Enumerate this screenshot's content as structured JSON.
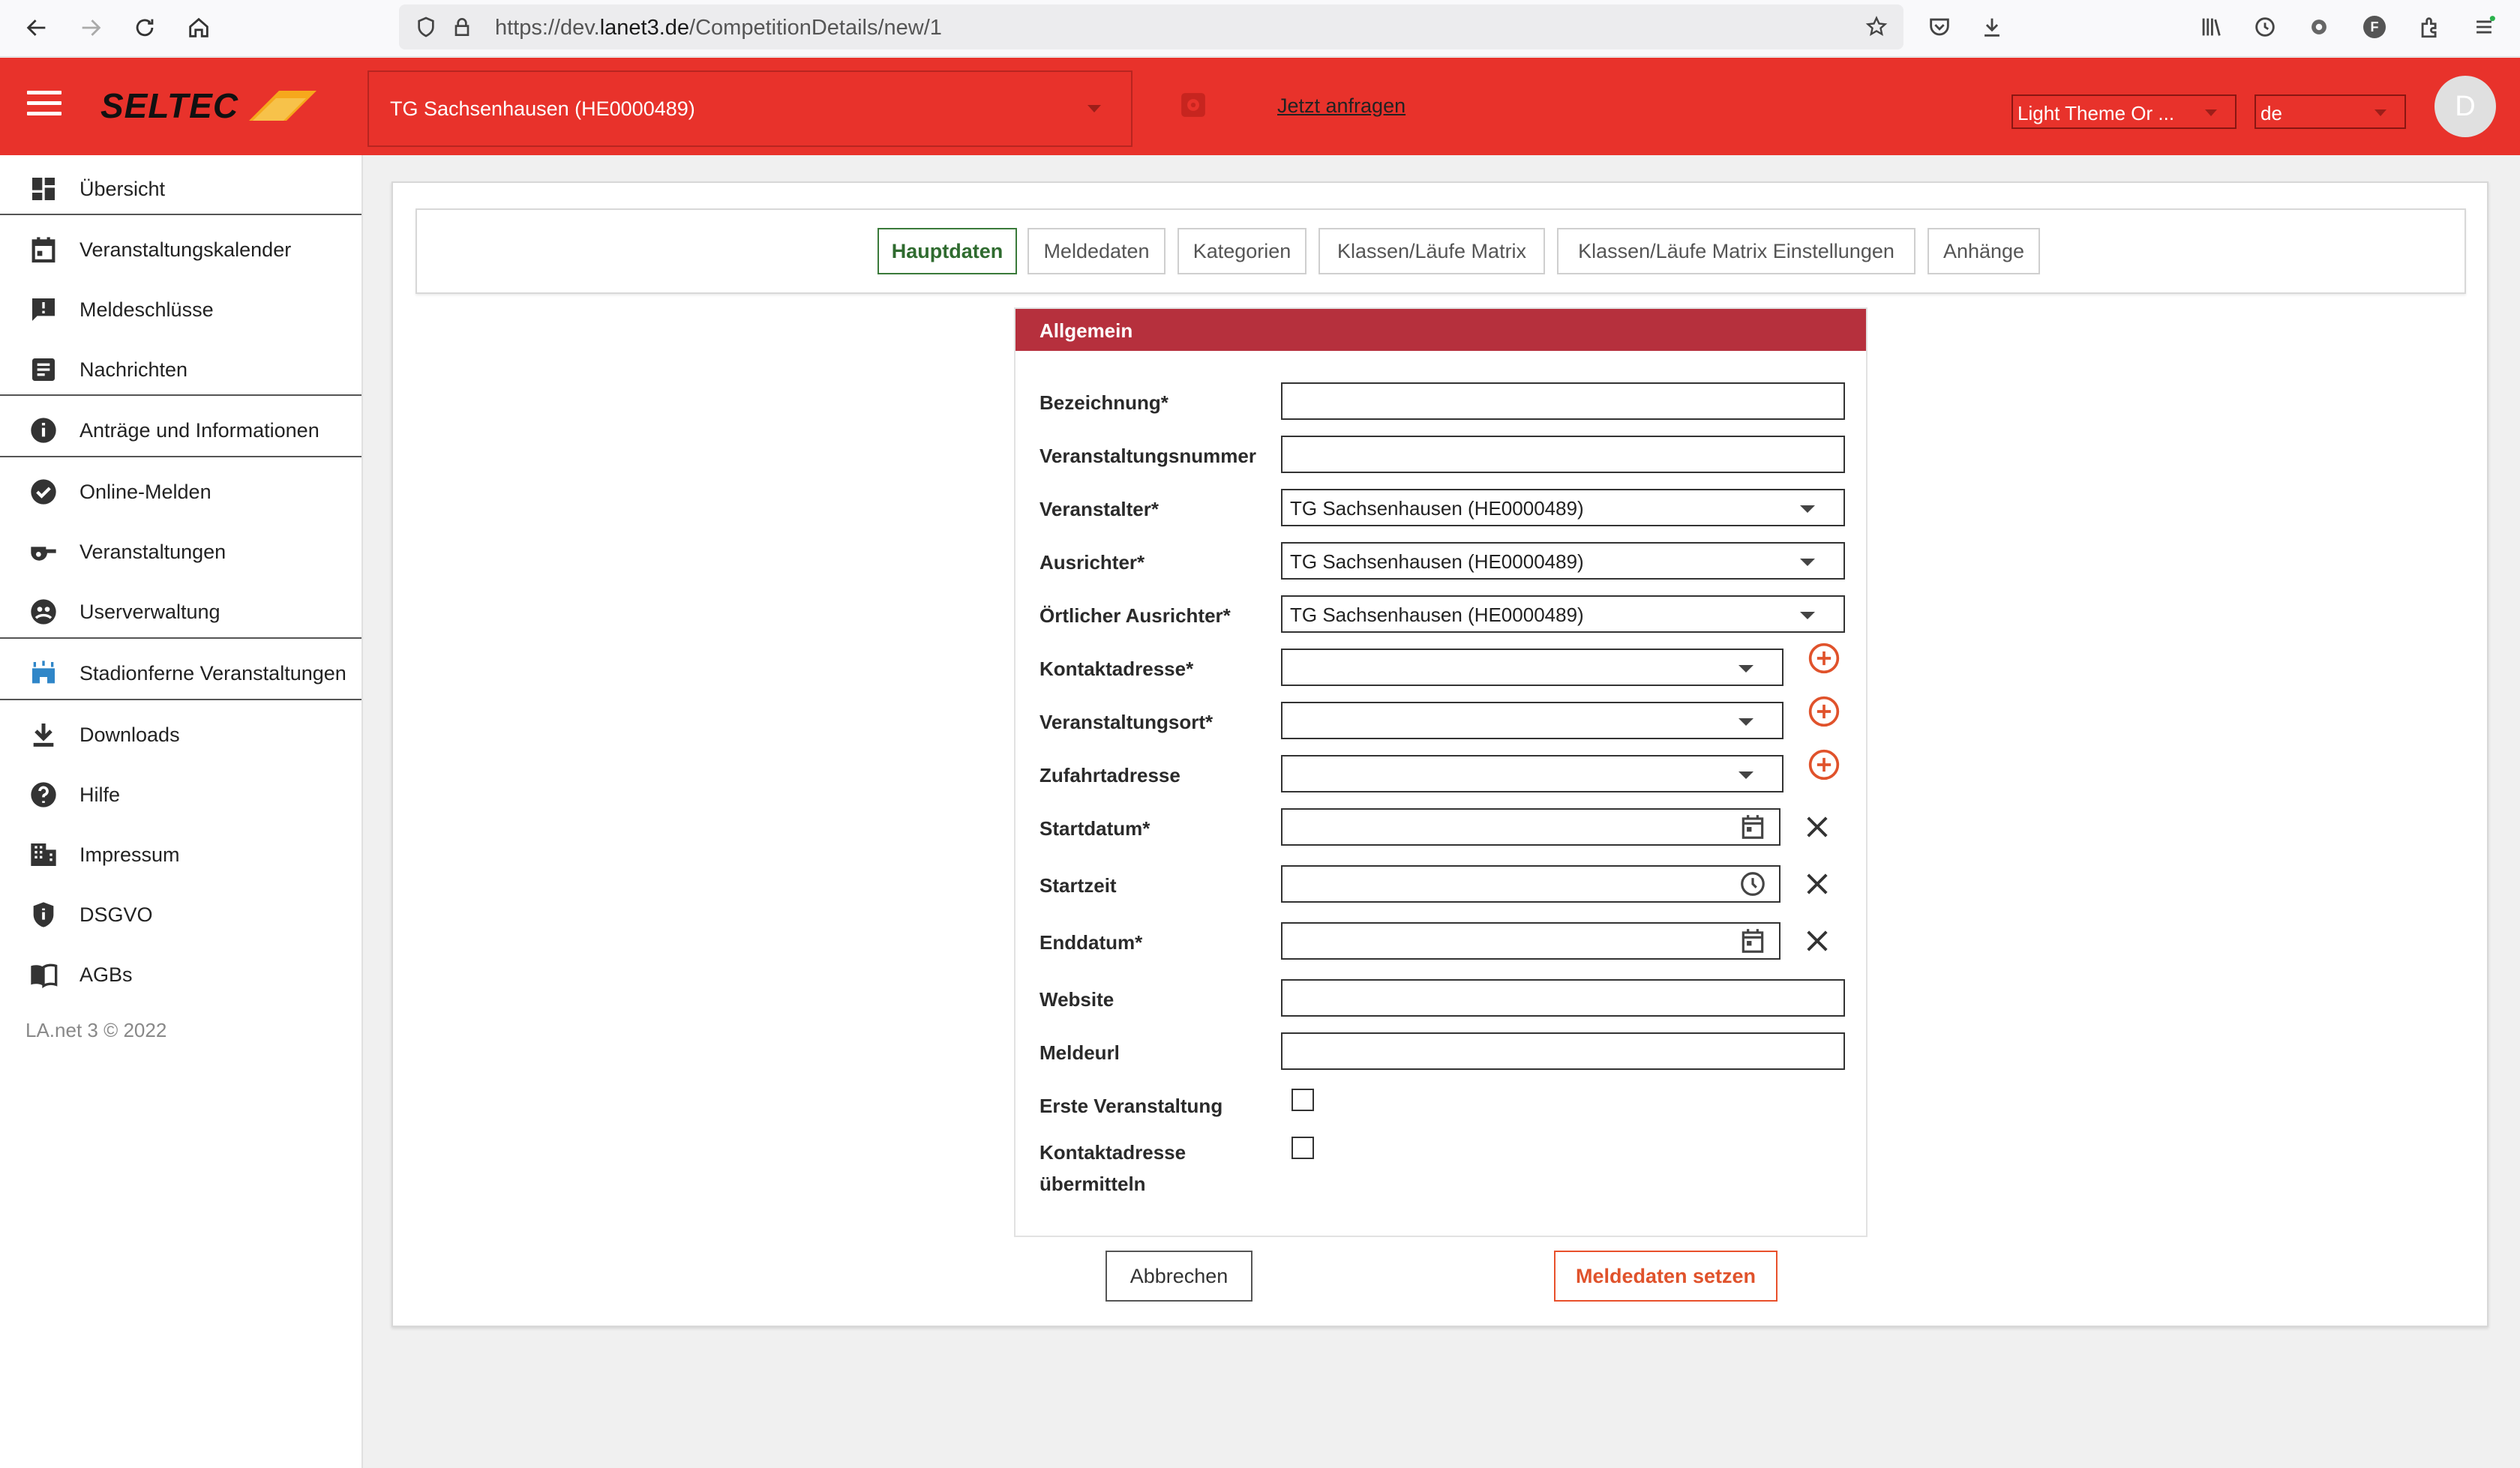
{
  "browser": {
    "url_prefix": "https://dev.",
    "url_domain": "lanet3.de",
    "url_path": "/CompetitionDetails/new/1",
    "profile_letter": "F"
  },
  "header": {
    "org_selected": "TG Sachsenhausen (HE0000489)",
    "request_link": "Jetzt anfragen",
    "theme_select": "Light Theme Or ...",
    "lang_select": "de",
    "avatar_letter": "D"
  },
  "sidebar": {
    "items": [
      {
        "label": "Übersicht",
        "icon": "dashboard-icon"
      },
      {
        "label": "Veranstaltungskalender",
        "icon": "calendar-icon"
      },
      {
        "label": "Meldeschlüsse",
        "icon": "feedback-icon"
      },
      {
        "label": "Nachrichten",
        "icon": "article-icon"
      },
      {
        "label": "Anträge und Informationen",
        "icon": "info-icon"
      },
      {
        "label": "Online-Melden",
        "icon": "check-circle-icon"
      },
      {
        "label": "Veranstaltungen",
        "icon": "whistle-icon"
      },
      {
        "label": "Userverwaltung",
        "icon": "support-icon"
      },
      {
        "label": "Stadionferne Veranstaltungen",
        "icon": "stadium-icon"
      },
      {
        "label": "Downloads",
        "icon": "download-icon"
      },
      {
        "label": "Hilfe",
        "icon": "help-icon"
      },
      {
        "label": "Impressum",
        "icon": "building-icon"
      },
      {
        "label": "DSGVO",
        "icon": "shield-icon"
      },
      {
        "label": "AGBs",
        "icon": "book-icon"
      }
    ],
    "copyright": "LA.net 3 © 2022"
  },
  "tabs": [
    "Hauptdaten",
    "Meldedaten",
    "Kategorien",
    "Klassen/Läufe Matrix",
    "Klassen/Läufe Matrix Einstellungen",
    "Anhänge"
  ],
  "form": {
    "section_title": "Allgemein",
    "labels": {
      "bezeichnung": "Bezeichnung*",
      "veranstaltungsnummer": "Veranstaltungsnummer",
      "veranstalter": "Veranstalter*",
      "ausrichter": "Ausrichter*",
      "oertlicher_ausrichter": "Örtlicher Ausrichter*",
      "kontaktadresse": "Kontaktadresse*",
      "veranstaltungsort": "Veranstaltungsort*",
      "zufahrtadresse": "Zufahrtadresse",
      "startdatum": "Startdatum*",
      "startzeit": "Startzeit",
      "enddatum": "Enddatum*",
      "website": "Website",
      "meldeurl": "Meldeurl",
      "erste_veranstaltung": "Erste Veranstaltung",
      "kontaktadresse_uebermitteln_1": "Kontaktadresse",
      "kontaktadresse_uebermitteln_2": "übermitteln"
    },
    "values": {
      "bezeichnung": "",
      "veranstaltungsnummer": "",
      "veranstalter": "TG Sachsenhausen (HE0000489)",
      "ausrichter": "TG Sachsenhausen (HE0000489)",
      "oertlicher_ausrichter": "TG Sachsenhausen (HE0000489)",
      "kontaktadresse": "",
      "veranstaltungsort": "",
      "zufahrtadresse": "",
      "startdatum": "",
      "startzeit": "",
      "enddatum": "",
      "website": "",
      "meldeurl": "",
      "erste_veranstaltung": false,
      "kontaktadresse_uebermitteln": false
    }
  },
  "actions": {
    "cancel": "Abbrechen",
    "primary": "Meldedaten setzen"
  },
  "colors": {
    "brand_red": "#e8322b",
    "section_red": "#b6303d",
    "active_tab_green": "#2f6b2f",
    "primary_orange": "#e0522b"
  }
}
